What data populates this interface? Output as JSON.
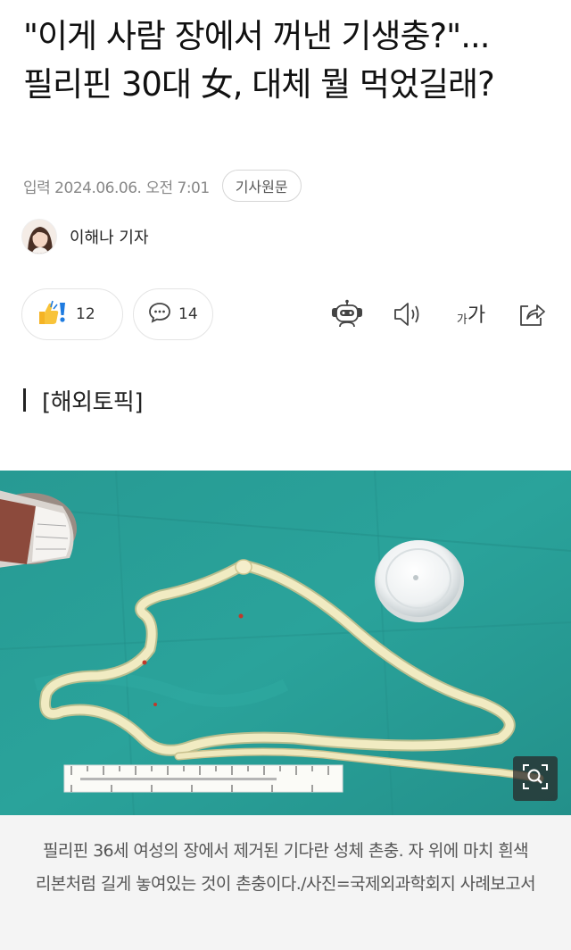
{
  "article": {
    "headline": "\"이게 사람 장에서 꺼낸 기생충?\"... 필리핀 30대 女, 대체 뭘 먹었길래?",
    "published": "입력 2024.06.06. 오전 7:01",
    "origin_button": "기사원문",
    "reporter": "이해나 기자",
    "section": "[해외토픽]",
    "caption": "필리핀 36세 여성의 장에서 제거된 기다란 성체 촌충. 자 위에 마치 흰색 리본처럼 길게 놓여있는 것이 촌충이다./사진=국제외과학회지 사례보고서"
  },
  "actions": {
    "reaction_count": "12",
    "comment_count": "14",
    "font_size_label": "가가"
  },
  "icons": {
    "reaction": "thumbs-up-exclamation-icon",
    "comment": "speech-bubble-icon",
    "summary_bot": "robot-icon",
    "listen": "speaker-icon",
    "font_size": "font-size-icon",
    "share": "share-icon",
    "zoom": "zoom-icon"
  },
  "colors": {
    "photo_background": "#2a9a92",
    "caption_background": "#f4f4f4",
    "meta_text": "#888888"
  }
}
